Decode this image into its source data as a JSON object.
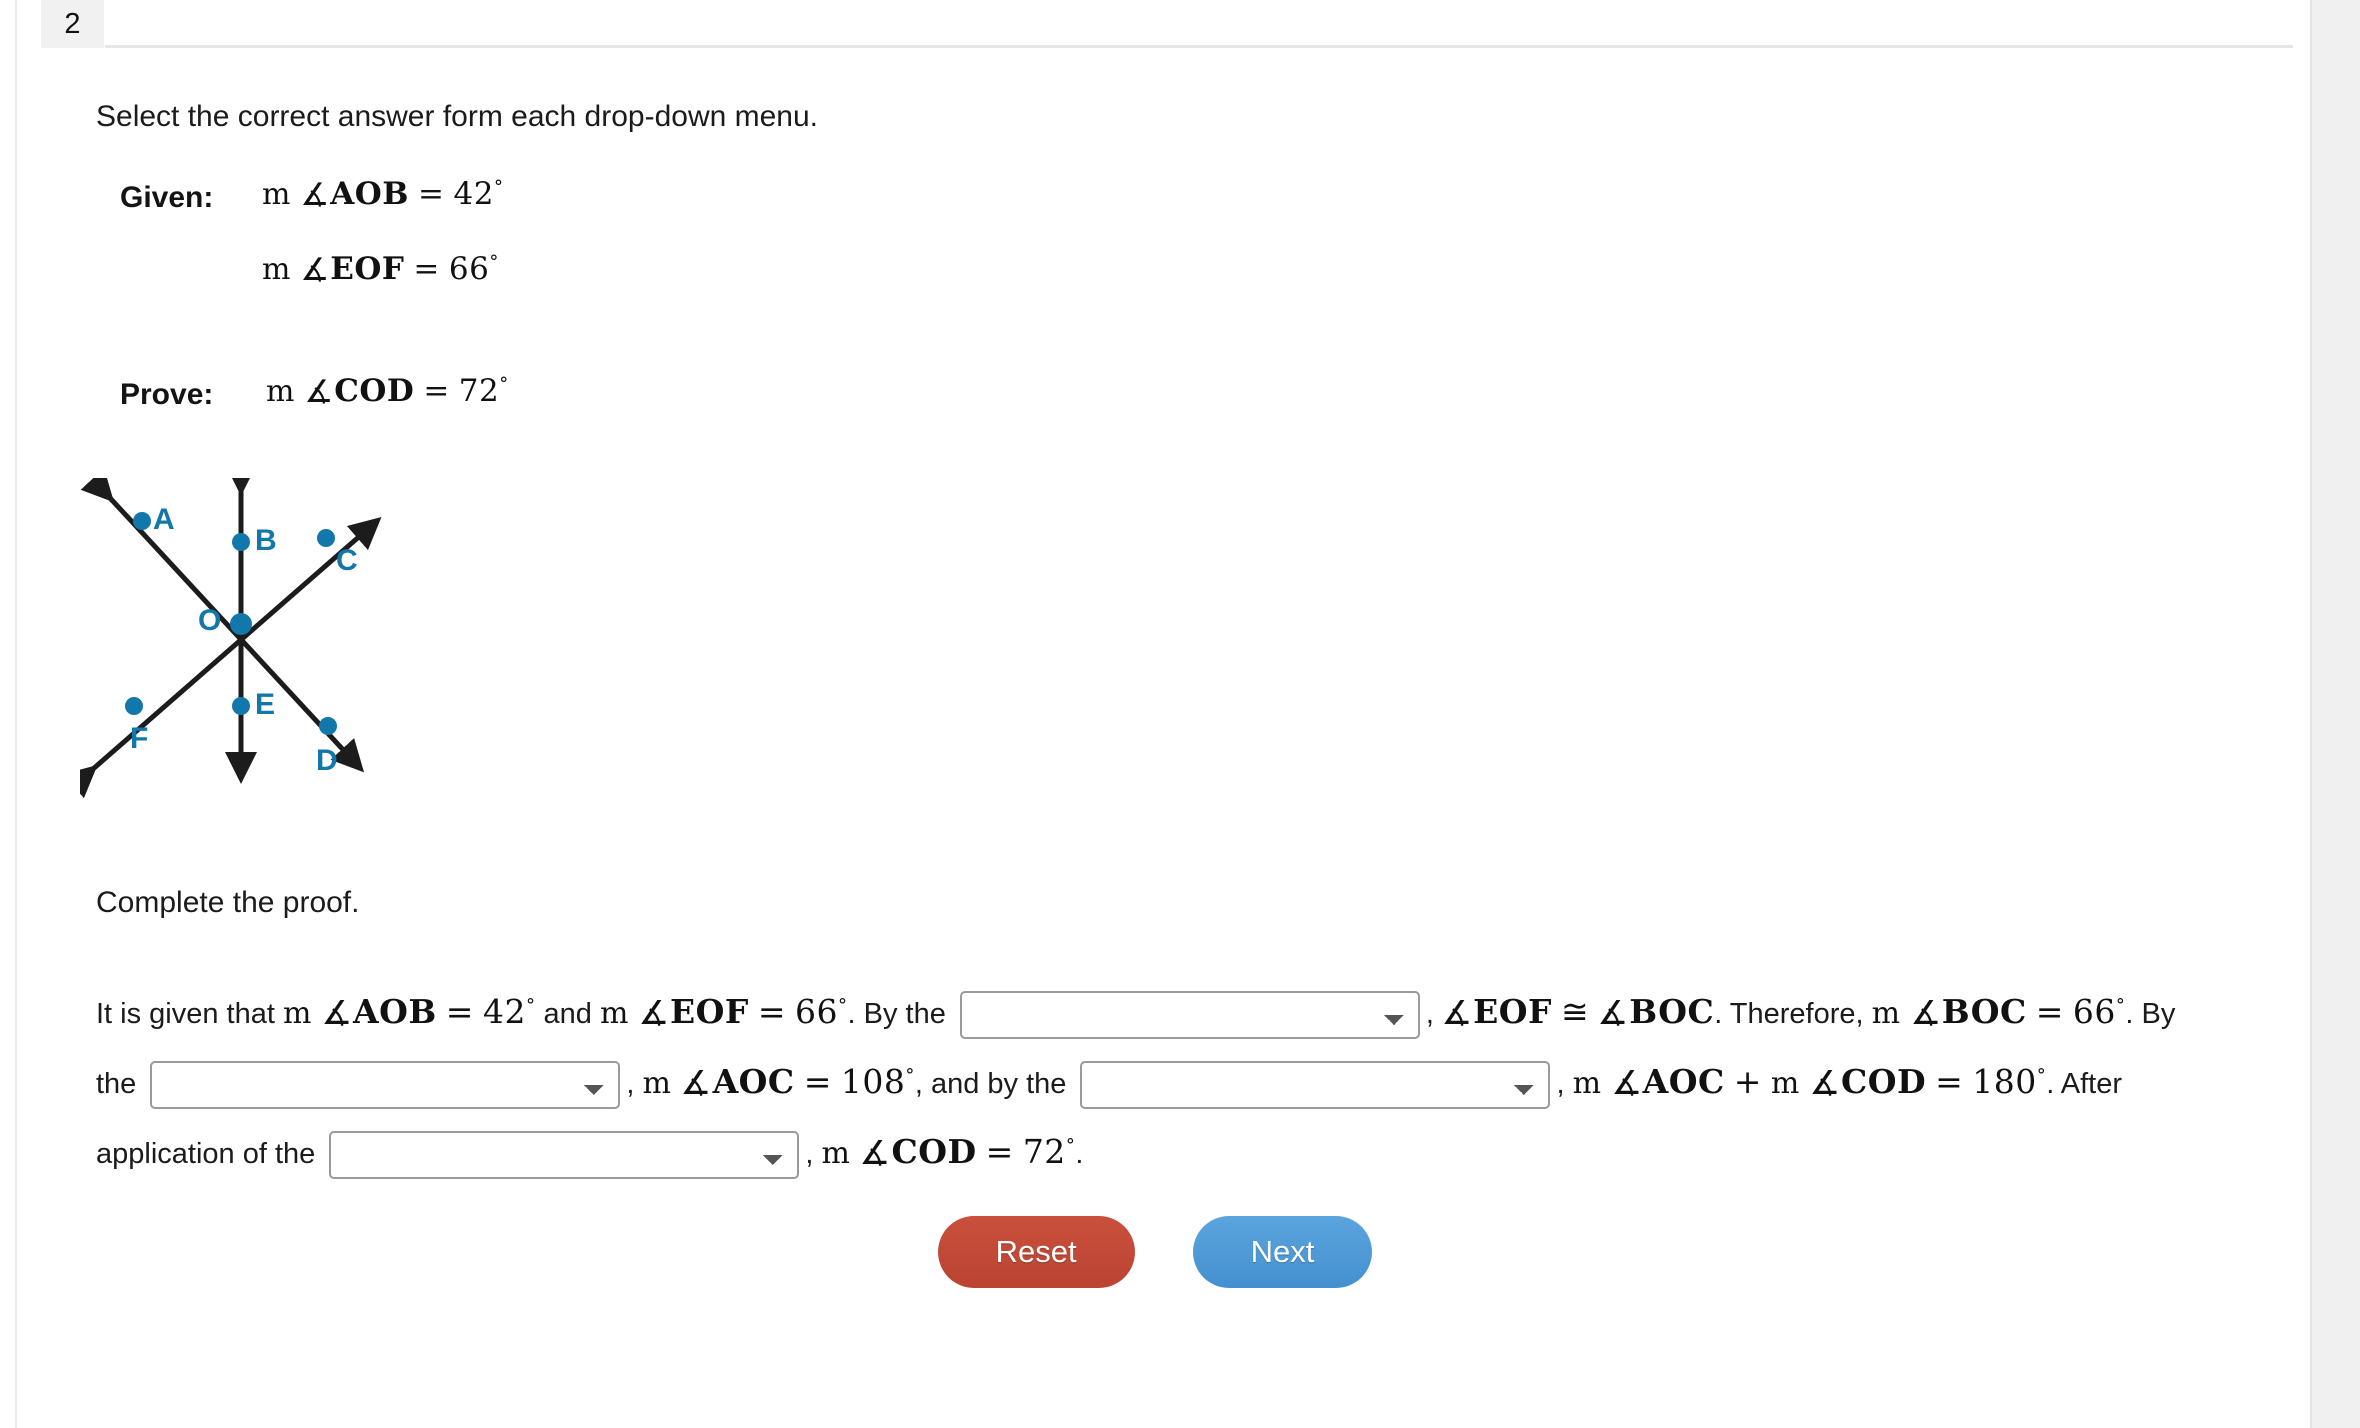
{
  "tab": {
    "label": "2"
  },
  "instruction": "Select the correct answer form each drop-down menu.",
  "given": {
    "label": "Given:",
    "lines": [
      {
        "m": "m",
        "angle": "∡",
        "points": "AOB",
        "eq": "=",
        "value": "42",
        "deg": "°"
      },
      {
        "m": "m",
        "angle": "∡",
        "points": "EOF",
        "eq": "=",
        "value": "66",
        "deg": "°"
      }
    ]
  },
  "prove": {
    "label": "Prove:",
    "lines": [
      {
        "m": "m",
        "angle": "∡",
        "points": "COD",
        "eq": "=",
        "value": "72",
        "deg": "°"
      }
    ]
  },
  "diagram": {
    "name": "three-intersecting-lines-diagram",
    "center_label": "O",
    "points": [
      {
        "id": "A",
        "label": "A"
      },
      {
        "id": "B",
        "label": "B"
      },
      {
        "id": "C",
        "label": "C"
      },
      {
        "id": "O",
        "label": "O"
      },
      {
        "id": "E",
        "label": "E"
      },
      {
        "id": "F",
        "label": "F"
      },
      {
        "id": "D",
        "label": "D"
      }
    ],
    "point_color": "#1277ab",
    "line_color": "#1c1c1c"
  },
  "complete_heading": "Complete the proof.",
  "proof": {
    "t1": "It is given that",
    "m1": {
      "m": "m",
      "angle": "∡",
      "points": "AOB",
      "eq": "=",
      "value": "42",
      "deg": "°"
    },
    "t2": "and",
    "m2": {
      "m": "m",
      "angle": "∡",
      "points": "EOF",
      "eq": "=",
      "value": "66",
      "deg": "°"
    },
    "t3": ". By the",
    "dropdown1": {
      "value": "",
      "placeholder": ""
    },
    "t4": ",",
    "m3": {
      "angle1": "∡",
      "points1": "EOF",
      "cong": "≅",
      "angle2": "∡",
      "points2": "BOC"
    },
    "t5": ". Therefore,",
    "m4": {
      "m": "m",
      "angle": "∡",
      "points": "BOC",
      "eq": "=",
      "value": "66",
      "deg": "°"
    },
    "t6": ". By the",
    "dropdown2": {
      "value": "",
      "placeholder": ""
    },
    "t7": ",",
    "m5": {
      "m": "m",
      "angle": "∡",
      "points": "AOC",
      "eq": "=",
      "value": "108",
      "deg": "°"
    },
    "t8": ", and by the",
    "dropdown3": {
      "value": "",
      "placeholder": ""
    },
    "t9": ",",
    "m6": {
      "m1": "m",
      "angle1": "∡",
      "points1": "AOC",
      "plus": "+",
      "m2": "m",
      "angle2": "∡",
      "points2": "COD",
      "eq": "=",
      "value": "180",
      "deg": "°"
    },
    "t10": ". After application of the",
    "dropdown4": {
      "value": "",
      "placeholder": ""
    },
    "t11": ",",
    "m7": {
      "m": "m",
      "angle": "∡",
      "points": "COD",
      "eq": "=",
      "value": "72",
      "deg": "°"
    },
    "t12": "."
  },
  "buttons": {
    "reset": "Reset",
    "next": "Next"
  },
  "colors": {
    "reset_bg": "#c24936",
    "next_bg": "#4e9ad7",
    "diagram_accent": "#1277ab",
    "tab_bg": "#f1f1f1"
  }
}
